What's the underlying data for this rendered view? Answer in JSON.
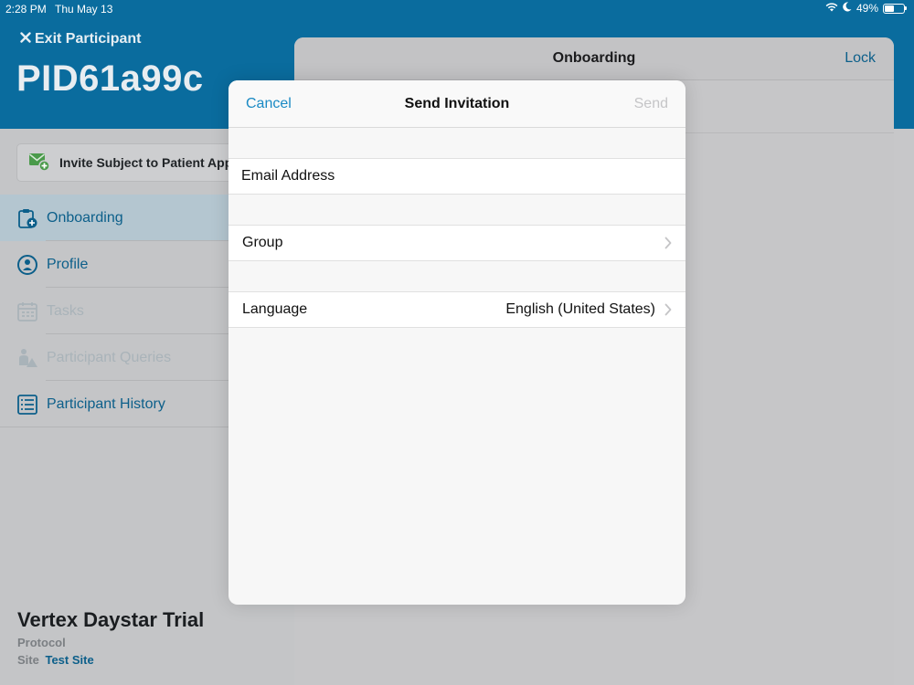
{
  "status_bar": {
    "time": "2:28 PM",
    "date": "Thu May 13",
    "battery": "49%",
    "battery_level": 0.49
  },
  "header": {
    "exit_label": "Exit Participant",
    "participant_id": "PID61a99c"
  },
  "sidebar": {
    "invite_label": "Invite Subject to Patient App",
    "items": [
      {
        "label": "Onboarding",
        "icon": "clipboard-plus-icon",
        "state": "active"
      },
      {
        "label": "Profile",
        "icon": "person-circle-icon",
        "state": "enabled"
      },
      {
        "label": "Tasks",
        "icon": "calendar-icon",
        "state": "disabled"
      },
      {
        "label": "Participant Queries",
        "icon": "person-warning-icon",
        "state": "disabled"
      },
      {
        "label": "Participant History",
        "icon": "list-history-icon",
        "state": "enabled"
      }
    ],
    "trial": {
      "name": "Vertex Daystar Trial",
      "protocol_label": "Protocol",
      "site_label": "Site",
      "site_value": "Test Site"
    }
  },
  "detail": {
    "title": "Onboarding",
    "lock_label": "Lock"
  },
  "modal": {
    "title": "Send Invitation",
    "cancel_label": "Cancel",
    "send_label": "Send",
    "email_placeholder": "Email Address",
    "email_value": "",
    "group_label": "Group",
    "group_value": "",
    "language_label": "Language",
    "language_value": "English (United States)"
  },
  "colors": {
    "brand_blue": "#0a6c9e",
    "link_blue": "#1a8ac4",
    "disabled_gray": "#c5c5c7"
  }
}
